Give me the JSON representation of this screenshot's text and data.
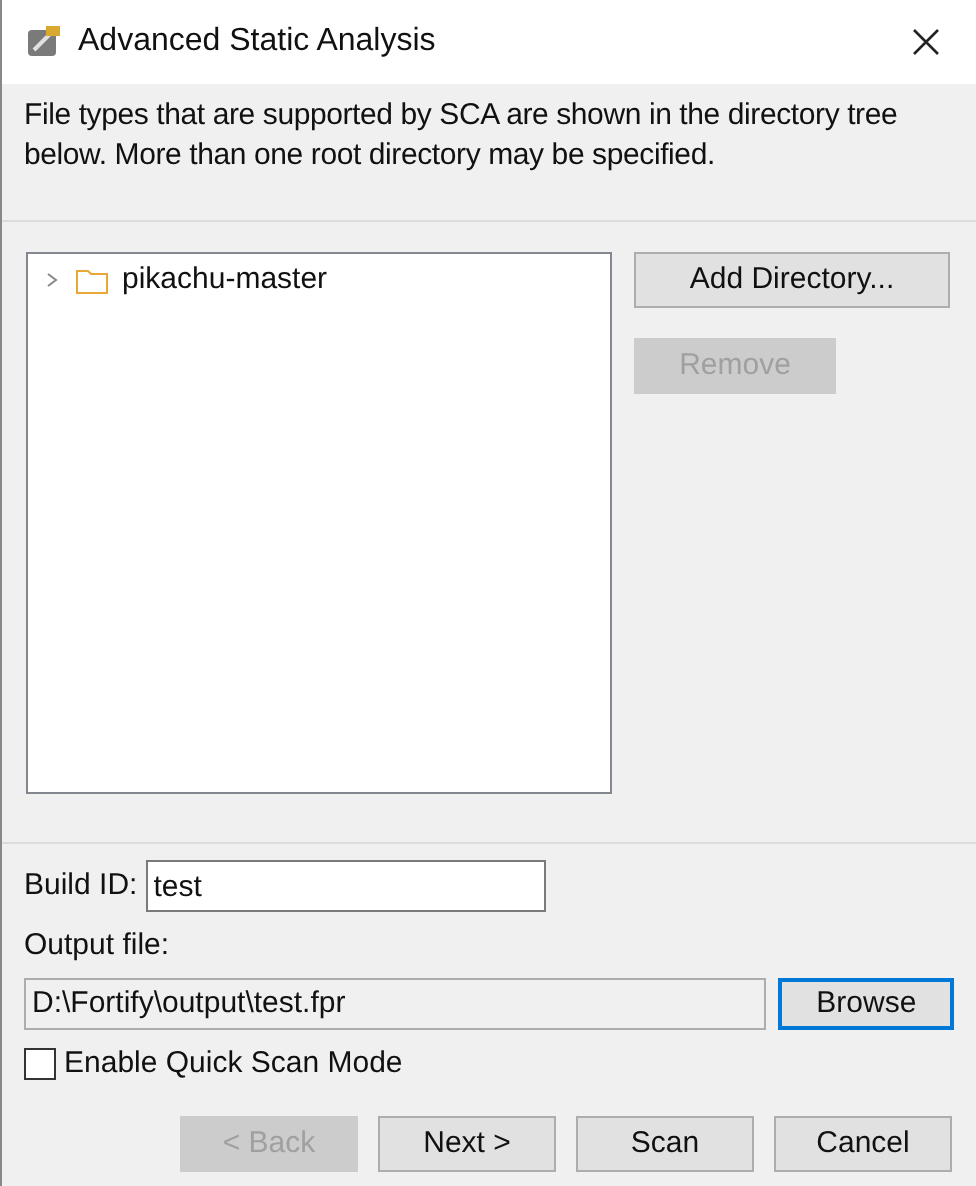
{
  "window": {
    "title": "Advanced Static Analysis"
  },
  "description": "File types that are supported by SCA are shown in the directory tree below.  More than one root directory may be specified.",
  "tree": [
    {
      "label": "pikachu-master",
      "expanded": false
    }
  ],
  "side_buttons": [
    {
      "label": "Add Directory...",
      "disabled": false
    },
    {
      "label": "Remove",
      "disabled": true
    }
  ],
  "build_id": {
    "label": "Build ID:",
    "value": "test"
  },
  "output_file": {
    "label": "Output file:",
    "value": "D:\\Fortify\\output\\test.fpr",
    "button": "Browse"
  },
  "quick_scan": {
    "label": "Enable Quick Scan Mode",
    "checked": false
  },
  "buttons": [
    {
      "label": "< Back",
      "disabled": true
    },
    {
      "label": "Next >",
      "disabled": false
    },
    {
      "label": "Scan",
      "disabled": false
    },
    {
      "label": "Cancel",
      "disabled": false
    }
  ]
}
